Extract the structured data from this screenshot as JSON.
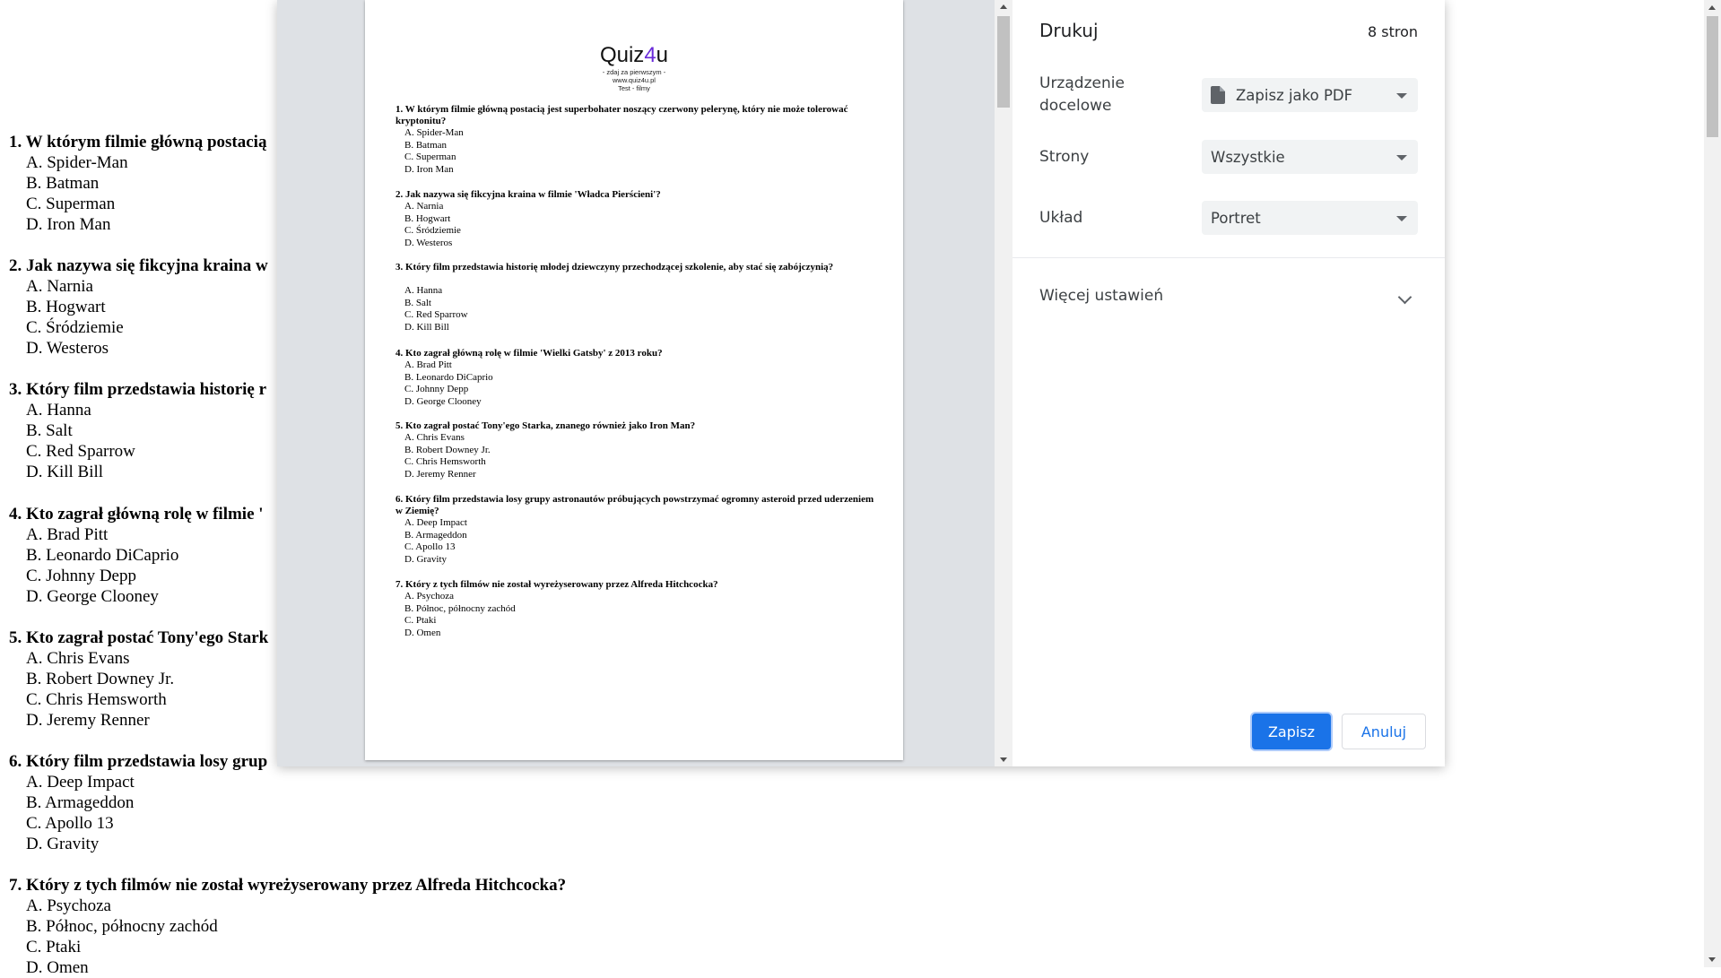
{
  "background_page": {
    "questions": [
      {
        "text": "1. W którym filmie główną postacią",
        "options": [
          "A. Spider-Man",
          "B. Batman",
          "C. Superman",
          "D. Iron Man"
        ]
      },
      {
        "text": "2. Jak nazywa się fikcyjna kraina w",
        "options": [
          "A. Narnia",
          "B. Hogwart",
          "C. Śródziemie",
          "D. Westeros"
        ]
      },
      {
        "text": "3. Który film przedstawia historię r",
        "options": [
          "A. Hanna",
          "B. Salt",
          "C. Red Sparrow",
          "D. Kill Bill"
        ]
      },
      {
        "text": "4. Kto zagrał główną rolę w filmie '",
        "options": [
          "A. Brad Pitt",
          "B. Leonardo DiCaprio",
          "C. Johnny Depp",
          "D. George Clooney"
        ]
      },
      {
        "text": "5. Kto zagrał postać Tony'ego Stark",
        "options": [
          "A. Chris Evans",
          "B. Robert Downey Jr.",
          "C. Chris Hemsworth",
          "D. Jeremy Renner"
        ]
      },
      {
        "text": "6. Który film przedstawia losy grup",
        "options": [
          "A. Deep Impact",
          "B. Armageddon",
          "C. Apollo 13",
          "D. Gravity"
        ]
      },
      {
        "text": "7. Który z tych filmów nie został wyreżyserowany przez Alfreda Hitchcocka?",
        "options": [
          "A. Psychoza",
          "B. Północ, północny zachód",
          "C. Ptaki",
          "D. Omen"
        ]
      }
    ]
  },
  "preview": {
    "logo_prefix": "Quiz",
    "logo_digit": "4",
    "logo_suffix": "u",
    "tagline": "- zdaj za pierwszym -",
    "site": "www.quiz4u.pl",
    "subtitle": "Test - filmy",
    "questions": [
      {
        "text": "1. W którym filmie główną postacią jest superbohater noszący czerwony pelerynę, który nie może tolerować kryptonitu?",
        "options": [
          "A. Spider-Man",
          "B. Batman",
          "C. Superman",
          "D. Iron Man"
        ]
      },
      {
        "text": "2. Jak nazywa się fikcyjna kraina w filmie 'Władca Pierścieni'?",
        "options": [
          "A. Narnia",
          "B. Hogwart",
          "C. Śródziemie",
          "D. Westeros"
        ]
      },
      {
        "text": "3. Który film przedstawia historię młodej dziewczyny przechodzącej szkolenie, aby stać się zabójczynią?",
        "options": [
          "A. Hanna",
          "B. Salt",
          "C. Red Sparrow",
          "D. Kill Bill"
        ]
      },
      {
        "text": "4. Kto zagrał główną rolę w filmie 'Wielki Gatsby' z 2013 roku?",
        "options": [
          "A. Brad Pitt",
          "B. Leonardo DiCaprio",
          "C. Johnny Depp",
          "D. George Clooney"
        ]
      },
      {
        "text": "5. Kto zagrał postać Tony'ego Starka, znanego również jako Iron Man?",
        "options": [
          "A. Chris Evans",
          "B. Robert Downey Jr.",
          "C. Chris Hemsworth",
          "D. Jeremy Renner"
        ]
      },
      {
        "text": "6. Który film przedstawia losy grupy astronautów próbujących powstrzymać ogromny asteroid przed uderzeniem w Ziemię?",
        "options": [
          "A. Deep Impact",
          "B. Armageddon",
          "C. Apollo 13",
          "D. Gravity"
        ]
      },
      {
        "text": "7. Który z tych filmów nie został wyreżyserowany przez Alfreda Hitchcocka?",
        "options": [
          "A. Psychoza",
          "B. Północ, północny zachód",
          "C. Ptaki",
          "D. Omen"
        ]
      }
    ]
  },
  "settings": {
    "title": "Drukuj",
    "page_count": "8 stron",
    "destination_label_1": "Urządzenie",
    "destination_label_2": "docelowe",
    "destination_value": "Zapisz jako PDF",
    "pages_label": "Strony",
    "pages_value": "Wszystkie",
    "layout_label": "Układ",
    "layout_value": "Portret",
    "more_settings": "Więcej ustawień",
    "save_button": "Zapisz",
    "cancel_button": "Anuluj",
    "accent_color": "#1a73e8"
  }
}
